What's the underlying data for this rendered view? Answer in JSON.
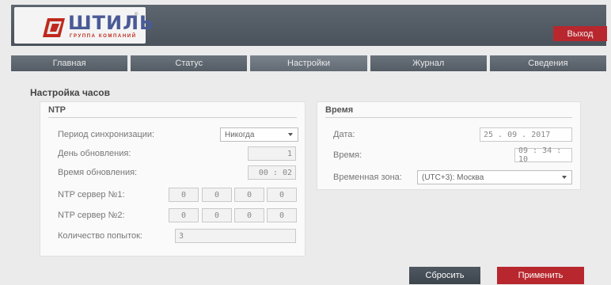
{
  "header": {
    "logo_name": "ШТИЛЬ",
    "logo_sub": "ГРУППА КОМПАНИЙ",
    "logo_reg": "®",
    "exit_label": "Выход"
  },
  "nav": {
    "tabs": [
      {
        "label": "Главная"
      },
      {
        "label": "Статус"
      },
      {
        "label": "Настройки"
      },
      {
        "label": "Журнал"
      },
      {
        "label": "Сведения"
      }
    ],
    "active": "Настройки"
  },
  "page": {
    "title": "Настройка часов"
  },
  "ntp": {
    "title": "NTP",
    "sync_period_label": "Период синхронизации:",
    "sync_period_value": "Никогда",
    "update_day_label": "День обновления:",
    "update_day_value": "1",
    "update_time_label": "Время обновления:",
    "update_time_value": "00 : 02",
    "server1_label": "NTP сервер №1:",
    "server1_octets": [
      "0",
      "0",
      "0",
      "0"
    ],
    "server2_label": "NTP сервер №2:",
    "server2_octets": [
      "0",
      "0",
      "0",
      "0"
    ],
    "attempts_label": "Количество попыток:",
    "attempts_value": "3"
  },
  "time": {
    "title": "Время",
    "date_label": "Дата:",
    "date_value": "25 . 09 . 2017",
    "time_label": "Время:",
    "time_value": "09 : 34 : 10",
    "zone_label": "Временная зона:",
    "zone_value": "(UTC+3): Москва"
  },
  "actions": {
    "reset_label": "Сбросить",
    "apply_label": "Применить"
  },
  "colors": {
    "accent": "#b8272e",
    "header_bg": "#535b64",
    "logo_blue": "#4a5a96"
  }
}
